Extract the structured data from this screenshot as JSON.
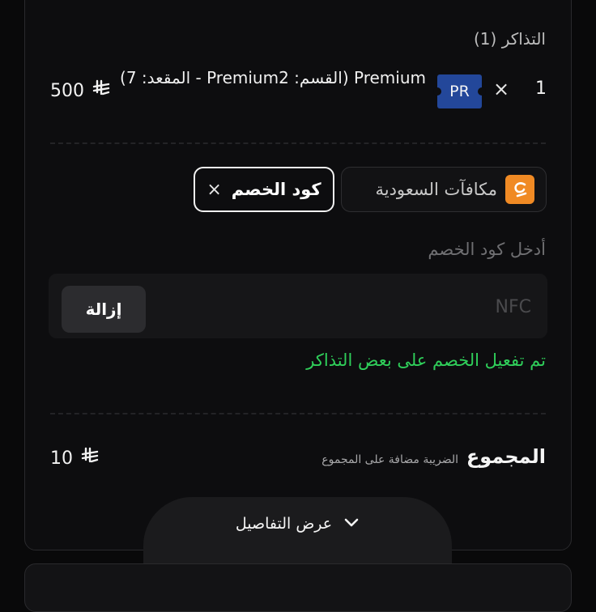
{
  "tickets": {
    "title": "التذاكر (1)",
    "items": [
      {
        "quantity": "1",
        "multiply": "×",
        "badge": "PR",
        "name": "Premium (القسم: Premium2 - المقعد: 7)",
        "price": "500"
      }
    ]
  },
  "currency_symbol": "⃁",
  "currency_fallback": "﷼",
  "chips": {
    "rewards_label": "مكافآت السعودية",
    "rewards_icon": "reward-logo-icon",
    "discount_label": "كود الخصم",
    "discount_close": "×"
  },
  "discount": {
    "label": "أدخل كود الخصم",
    "value": "NFC",
    "remove_label": "إزالة",
    "success_message": "تم تفعيل الخصم على بعض التذاكر"
  },
  "summary": {
    "total_label": "المجموع",
    "tax_note": "الضريبة مضافة على المجموع",
    "total_value": "10"
  },
  "details": {
    "label": "عرض التفاصيل",
    "icon": "chevron-down-icon"
  },
  "colors": {
    "accent_green": "#2fcf5a",
    "badge_blue": "#23479a",
    "reward_orange": "#f08a24"
  }
}
